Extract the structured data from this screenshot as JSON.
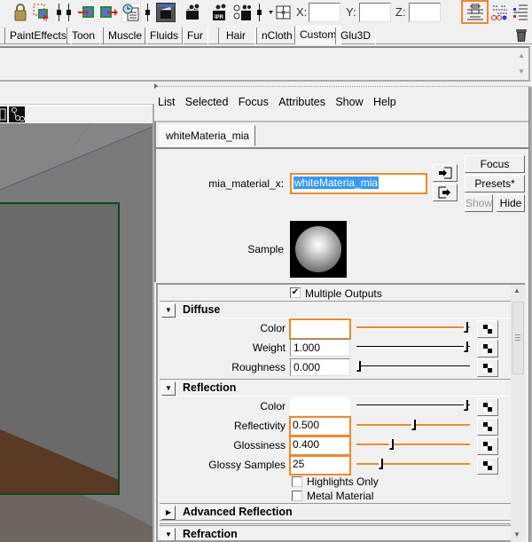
{
  "toolbar": {
    "icons": [
      "lock-icon",
      "select-camera-icon",
      "input-connection-icon",
      "output-connection-icon",
      "history-icon",
      "render-view-icon",
      "render-current-icon",
      "ipr-render-icon",
      "batch-render-icon",
      "snap-toggle-icon"
    ],
    "coords": {
      "x_label": "X:",
      "y_label": "Y:",
      "z_label": "Z:",
      "x_value": "",
      "y_value": "",
      "z_value": ""
    },
    "right_icons": [
      "attribute-editor-icon",
      "channel-box-icon",
      "tool-settings-icon"
    ]
  },
  "shelf": {
    "tabs": [
      "PaintEffects",
      "Toon",
      "Muscle",
      "Fluids",
      "Fur",
      "Hair",
      "nCloth",
      "Custom",
      "Glu3D"
    ],
    "active": "Custom"
  },
  "attribute_editor": {
    "menu": [
      "List",
      "Selected",
      "Focus",
      "Attributes",
      "Show",
      "Help"
    ],
    "node_tab": "whiteMateria_mia",
    "type_label": "mia_material_x:",
    "node_name": "whiteMateria_mia",
    "buttons": {
      "focus": "Focus",
      "presets": "Presets*",
      "show": "Show",
      "hide": "Hide"
    },
    "sample_label": "Sample",
    "multiple_outputs": {
      "label": "Multiple Outputs",
      "checked": true
    },
    "sections": {
      "diffuse": {
        "title": "Diffuse",
        "expanded": true,
        "attrs": [
          {
            "label": "Color",
            "value": "",
            "swatch": "#ffffff",
            "slider": 1.0
          },
          {
            "label": "Weight",
            "value": "1.000",
            "slider": 1.0
          },
          {
            "label": "Roughness",
            "value": "0.000",
            "slider": 0.0
          }
        ]
      },
      "reflection": {
        "title": "Reflection",
        "expanded": true,
        "attrs": [
          {
            "label": "Color",
            "value": "",
            "swatch": "#ffffff",
            "slider": 1.0
          },
          {
            "label": "Reflectivity",
            "value": "0.500",
            "slider": 0.5
          },
          {
            "label": "Glossiness",
            "value": "0.400",
            "slider": 0.4
          },
          {
            "label": "Glossy Samples",
            "value": "25",
            "slider": 0.25
          }
        ],
        "checkboxes": [
          {
            "label": "Highlights Only",
            "checked": false
          },
          {
            "label": "Metal Material",
            "checked": false
          }
        ]
      },
      "advanced_reflection": {
        "title": "Advanced Reflection",
        "expanded": false
      },
      "refraction": {
        "title": "Refraction",
        "expanded": true
      }
    }
  },
  "colors": {
    "highlight": "#f0882a",
    "selection": "#3399ff",
    "viewport_wall": "#6a6a6a",
    "floor_wood": "#5a3a22"
  }
}
